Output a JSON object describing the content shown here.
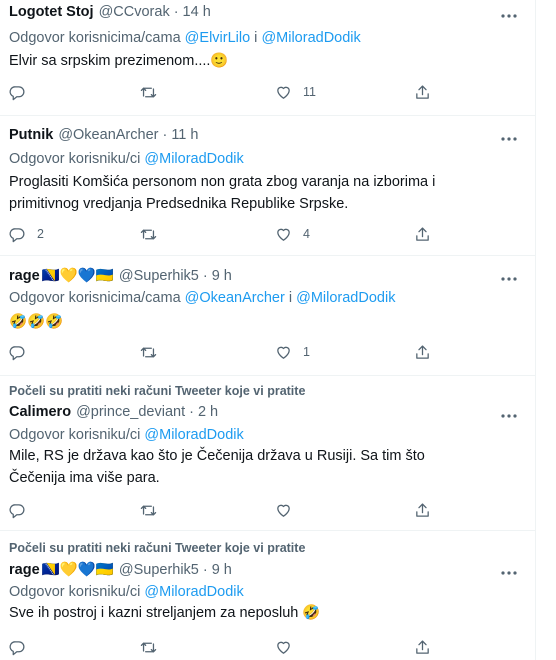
{
  "tweets": [
    {
      "name": "Logotet Stoj",
      "handle": "@CCvorak",
      "time": "14 h",
      "reply_prefix": "Odgovor korisnicima/cama ",
      "reply_mentions": [
        "@ElvirLilo",
        "@MiloradDodik"
      ],
      "reply_join": " i ",
      "text": "Elvir sa srpskim prezimenom....🙂",
      "replies": "",
      "retweets": "",
      "likes": "11"
    },
    {
      "name": "Putnik",
      "handle": "@OkeanArcher",
      "time": "11 h",
      "reply_prefix": "Odgovor korisniku/ci ",
      "reply_mentions": [
        "@MiloradDodik"
      ],
      "text": "Proglasiti Komšića personom non grata zbog varanja na izborima i primitivnog vredjanja Predsednika Republike Srpske.",
      "replies": "2",
      "retweets": "",
      "likes": "4"
    },
    {
      "name": "rage",
      "name_emojis": "🇧🇦💛💙🇺🇦",
      "handle": "@Superhik5",
      "time": "9 h",
      "reply_prefix": "Odgovor korisnicima/cama ",
      "reply_mentions": [
        "@OkeanArcher",
        "@MiloradDodik"
      ],
      "reply_join": " i ",
      "text": "🤣🤣🤣",
      "replies": "",
      "retweets": "",
      "likes": "1"
    },
    {
      "social_context": "Počeli su pratiti neki računi Tweeter koje vi pratite",
      "name": "Calimero",
      "handle": "@prince_deviant",
      "time": "2 h",
      "reply_prefix": "Odgovor korisniku/ci ",
      "reply_mentions": [
        "@MiloradDodik"
      ],
      "text": "Mile, RS je država kao što je Čečenija država u Rusiji. Sa tim što Čečenija ima više para.",
      "replies": "",
      "retweets": "",
      "likes": ""
    },
    {
      "social_context": "Počeli su pratiti neki računi Tweeter koje vi pratite",
      "name": "rage",
      "name_emojis": "🇧🇦💛💙🇺🇦",
      "handle": "@Superhik5",
      "time": "9 h",
      "reply_prefix": "Odgovor korisniku/ci ",
      "reply_mentions": [
        "@MiloradDodik"
      ],
      "text": "Sve ih postroj i kazni streljanjem za neposluh 🤣",
      "replies": "",
      "retweets": "",
      "likes": ""
    }
  ],
  "dot": "·",
  "colors": {
    "text": "#0f1419",
    "secondary": "#536471",
    "link": "#1d9bf0",
    "border": "#eff3f4"
  },
  "icons": [
    "reply-icon",
    "retweet-icon",
    "like-icon",
    "share-icon",
    "more-icon"
  ]
}
